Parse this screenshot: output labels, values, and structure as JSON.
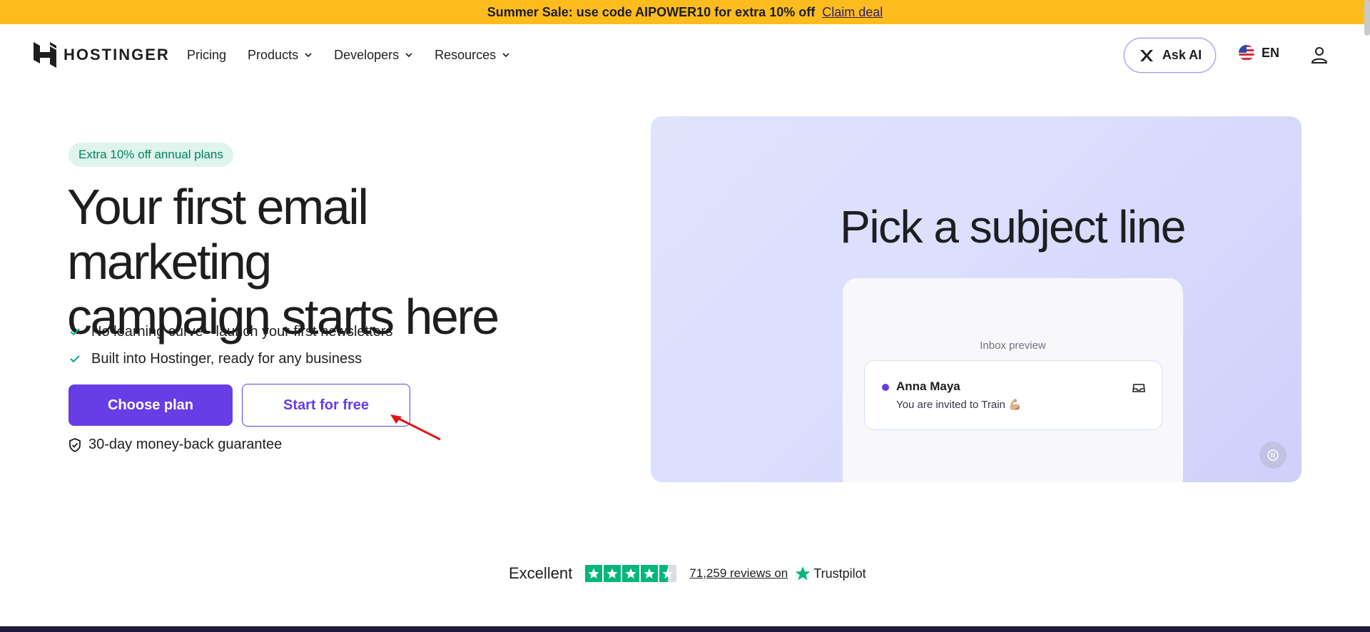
{
  "promo": {
    "text": "Summer Sale: use code AIPOWER10 for extra 10% off",
    "link": "Claim deal",
    "bg_color": "#fdbc1e"
  },
  "header": {
    "brand": "HOSTINGER",
    "nav": [
      {
        "label": "Pricing",
        "has_dropdown": false
      },
      {
        "label": "Products",
        "has_dropdown": true
      },
      {
        "label": "Developers",
        "has_dropdown": true
      },
      {
        "label": "Resources",
        "has_dropdown": true
      }
    ],
    "ask_ai": "Ask AI",
    "language": "EN",
    "icons": [
      "hostinger-logo-icon",
      "ask-ai-icon",
      "us-flag-icon",
      "user-account-icon"
    ]
  },
  "hero": {
    "badge": "Extra 10% off annual plans",
    "title_line1": "Your first email marketing",
    "title_line2": "campaign starts here",
    "bullets": [
      "No learning curve - launch your first newsletters",
      "Built into Hostinger, ready for any business"
    ],
    "primary_cta": "Choose plan",
    "secondary_cta": "Start for free",
    "guarantee": "30-day money-back guarantee",
    "accent_color": "#673de6"
  },
  "panel": {
    "title": "Pick a subject line",
    "preview_label": "Inbox preview",
    "sender": "Anna Maya",
    "subject": "You are invited to Train 💪🏼"
  },
  "trustpilot": {
    "rating_text": "Excellent",
    "stars": 4.5,
    "reviews": "71,259 reviews on",
    "brand": "Trustpilot",
    "star_color": "#00b67a"
  }
}
